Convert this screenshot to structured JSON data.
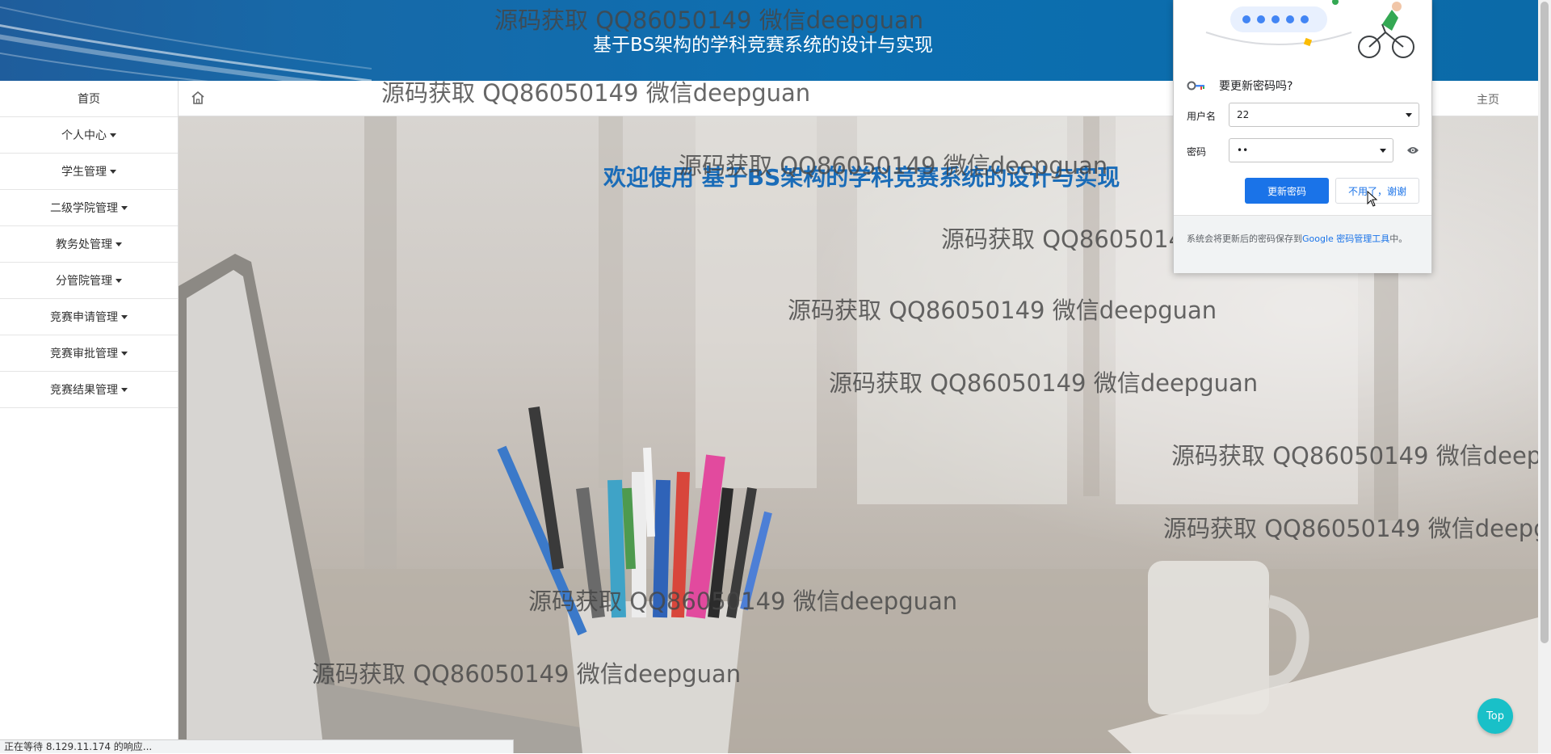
{
  "header": {
    "title": "基于BS架构的学科竞赛系统的设计与实现"
  },
  "sidebar": {
    "items": [
      {
        "label": "首页",
        "dropdown": false
      },
      {
        "label": "个人中心",
        "dropdown": true
      },
      {
        "label": "学生管理",
        "dropdown": true
      },
      {
        "label": "二级学院管理",
        "dropdown": true
      },
      {
        "label": "教务处管理",
        "dropdown": true
      },
      {
        "label": "分管院管理",
        "dropdown": true
      },
      {
        "label": "竞赛申请管理",
        "dropdown": true
      },
      {
        "label": "竞赛审批管理",
        "dropdown": true
      },
      {
        "label": "竞赛结果管理",
        "dropdown": true
      }
    ]
  },
  "topnav": {
    "home_link": "主页"
  },
  "main": {
    "welcome": "欢迎使用 基于BS架构的学科竞赛系统的设计与实现"
  },
  "watermark": {
    "text": "源码获取 QQ86050149 微信deepguan"
  },
  "password_popup": {
    "title": "要更新密码吗?",
    "username_label": "用户名",
    "username_value": "22",
    "password_label": "密码",
    "password_value": "••",
    "update_button": "更新密码",
    "dismiss_button": "不用了，谢谢",
    "footer_text_a": "系统会将更新后的密码保存到",
    "footer_link": "Google 密码管理工具",
    "footer_text_b": "中。"
  },
  "top_button": "Top",
  "status_bar": "正在等待 8.129.11.174 的响应...",
  "colors": {
    "header_bg": "#0d6fb1",
    "welcome_text": "#1a6cb8",
    "primary_button": "#1a73e8",
    "top_button": "#19c0c8"
  }
}
